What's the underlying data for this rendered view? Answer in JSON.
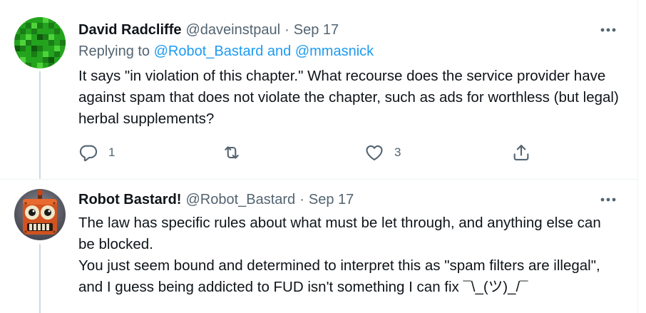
{
  "tweets": [
    {
      "display_name": "David Radcliffe",
      "handle": "@daveinstpaul",
      "separator": "·",
      "date": "Sep 17",
      "replying": {
        "prefix": "Replying to ",
        "mention_1": "@Robot_Bastard",
        "conjunction": " and ",
        "mention_2": "@mmasnick"
      },
      "body_lines": [
        "It says \"in violation of this chapter.\" What recourse does the service provider have against spam that does not violate the chapter, such as ads for worthless (but legal) herbal supplements?"
      ],
      "reply_count": "1",
      "like_count": "3",
      "avatar_icon": "green-pixel-avatar"
    },
    {
      "display_name": "Robot Bastard!",
      "handle": "@Robot_Bastard",
      "separator": "·",
      "date": "Sep 17",
      "body_lines": [
        "The law has specific rules about what must be let through, and anything else can be blocked.",
        "You just seem bound and determined to interpret this as \"spam filters are illegal\", and I guess being addicted to FUD isn't something I can fix ¯\\_(ツ)_/¯"
      ],
      "avatar_icon": "orange-robot-avatar"
    }
  ],
  "colors": {
    "text_primary": "#0f1419",
    "text_secondary": "#536471",
    "link": "#1d9bf0",
    "thread_line": "#cfd9de",
    "separator": "#eff3f4"
  }
}
